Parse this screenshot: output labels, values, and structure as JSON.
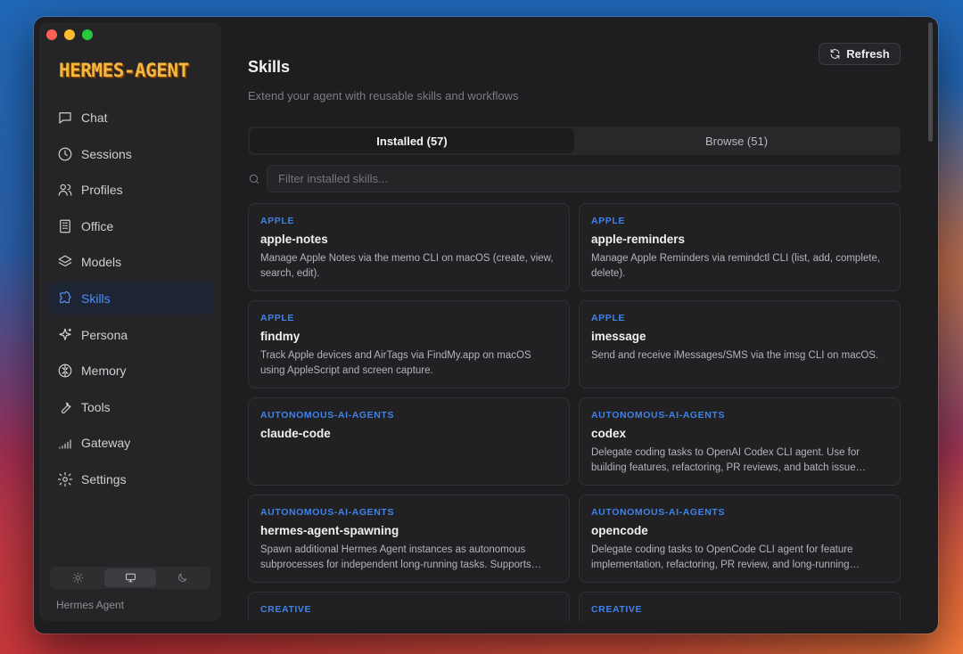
{
  "app": {
    "logo_text": "HERMES-AGENT",
    "footer": "Hermes Agent"
  },
  "sidebar": {
    "items": [
      {
        "label": "Chat",
        "icon": "chat-icon"
      },
      {
        "label": "Sessions",
        "icon": "clock-icon"
      },
      {
        "label": "Profiles",
        "icon": "users-icon"
      },
      {
        "label": "Office",
        "icon": "building-icon"
      },
      {
        "label": "Models",
        "icon": "layers-icon"
      },
      {
        "label": "Skills",
        "icon": "puzzle-icon",
        "active": true
      },
      {
        "label": "Persona",
        "icon": "sparkle-icon"
      },
      {
        "label": "Memory",
        "icon": "brain-icon"
      },
      {
        "label": "Tools",
        "icon": "wrench-icon"
      },
      {
        "label": "Gateway",
        "icon": "signal-icon"
      },
      {
        "label": "Settings",
        "icon": "gear-icon"
      }
    ],
    "theme_options": [
      "light",
      "system",
      "dark"
    ],
    "theme_selected": "system"
  },
  "header": {
    "title": "Skills",
    "subtitle": "Extend your agent with reusable skills and workflows",
    "refresh_label": "Refresh"
  },
  "tabs": [
    {
      "label": "Installed (57)",
      "active": true
    },
    {
      "label": "Browse (51)",
      "active": false
    }
  ],
  "search": {
    "placeholder": "Filter installed skills...",
    "value": ""
  },
  "skills": [
    {
      "category": "APPLE",
      "name": "apple-notes",
      "description": "Manage Apple Notes via the memo CLI on macOS (create, view, search, edit)."
    },
    {
      "category": "APPLE",
      "name": "apple-reminders",
      "description": "Manage Apple Reminders via remindctl CLI (list, add, complete, delete)."
    },
    {
      "category": "APPLE",
      "name": "findmy",
      "description": "Track Apple devices and AirTags via FindMy.app on macOS using AppleScript and screen capture."
    },
    {
      "category": "APPLE",
      "name": "imessage",
      "description": "Send and receive iMessages/SMS via the imsg CLI on macOS."
    },
    {
      "category": "AUTONOMOUS-AI-AGENTS",
      "name": "claude-code",
      "description": ""
    },
    {
      "category": "AUTONOMOUS-AI-AGENTS",
      "name": "codex",
      "description": "Delegate coding tasks to OpenAI Codex CLI agent. Use for building features, refactoring, PR reviews, and batch issue…"
    },
    {
      "category": "AUTONOMOUS-AI-AGENTS",
      "name": "hermes-agent-spawning",
      "description": "Spawn additional Hermes Agent instances as autonomous subprocesses for independent long-running tasks. Supports…"
    },
    {
      "category": "AUTONOMOUS-AI-AGENTS",
      "name": "opencode",
      "description": "Delegate coding tasks to OpenCode CLI agent for feature implementation, refactoring, PR review, and long-running…"
    },
    {
      "category": "CREATIVE",
      "name": "",
      "description": ""
    },
    {
      "category": "CREATIVE",
      "name": "",
      "description": ""
    }
  ],
  "colors": {
    "accent": "#3f82e8",
    "active_nav_bg": "#1d2433",
    "window_bg": "#1e1e20"
  }
}
